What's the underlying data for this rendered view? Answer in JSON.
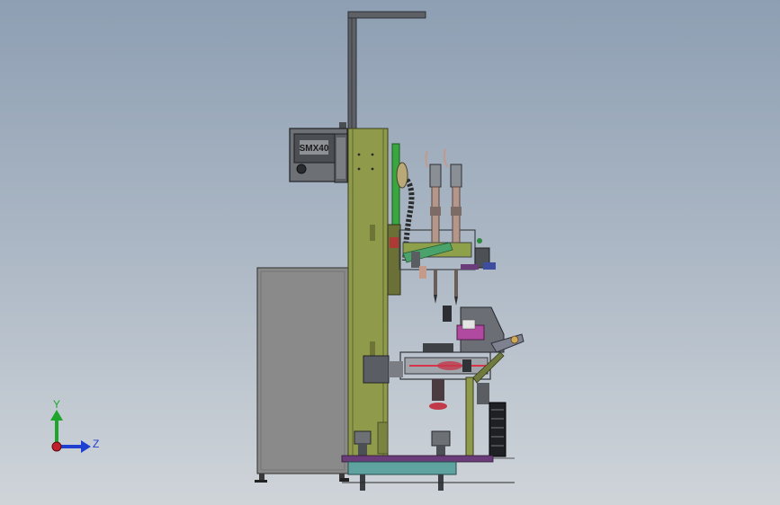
{
  "machine": {
    "control_box_label": "SMX40"
  },
  "triad": {
    "y_label": "Y",
    "z_label": "Z"
  },
  "colors": {
    "background_top": "#8e9fb3",
    "background_bottom": "#cfd4d9",
    "column_olive": "#8f9a4a",
    "cabinet_gray": "#8a8a8a",
    "frame_dark": "#3e4247",
    "accent_green": "#3aa640",
    "accent_magenta": "#b04aa0",
    "base_teal": "#5fa3a0",
    "tool_copper": "#c49a8a"
  }
}
